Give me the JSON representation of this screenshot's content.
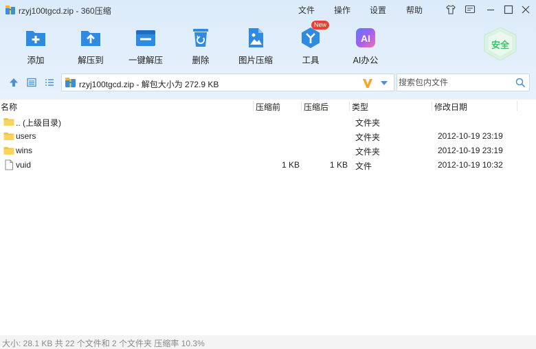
{
  "window": {
    "title": "rzyj100tgcd.zip - 360压缩",
    "menus": [
      "文件",
      "操作",
      "设置",
      "帮助"
    ]
  },
  "toolbar": {
    "items": [
      {
        "label": "添加",
        "icon": "add-icon"
      },
      {
        "label": "解压到",
        "icon": "extract-to-icon"
      },
      {
        "label": "一键解压",
        "icon": "one-click-extract-icon"
      },
      {
        "label": "删除",
        "icon": "delete-icon"
      },
      {
        "label": "图片压缩",
        "icon": "image-compress-icon"
      },
      {
        "label": "工具",
        "icon": "tools-icon"
      },
      {
        "label": "AI办公",
        "icon": "ai-office-icon"
      }
    ],
    "new_badge": "New",
    "safe_badge": "安全"
  },
  "address": {
    "text": "rzyj100tgcd.zip - 解包大小为 272.9 KB"
  },
  "search": {
    "placeholder": "搜索包内文件"
  },
  "list": {
    "columns": {
      "name": "名称",
      "compressed_before": "压缩前",
      "compressed_after": "压缩后",
      "type": "类型",
      "modified": "修改日期"
    },
    "rows": [
      {
        "icon": "folder-icon",
        "name": ".. (上级目录)",
        "before": "",
        "after": "",
        "type": "文件夹",
        "modified": ""
      },
      {
        "icon": "folder-icon",
        "name": "users",
        "before": "",
        "after": "",
        "type": "文件夹",
        "modified": "2012-10-19 23:19"
      },
      {
        "icon": "folder-icon",
        "name": "wins",
        "before": "",
        "after": "",
        "type": "文件夹",
        "modified": "2012-10-19 23:19"
      },
      {
        "icon": "file-icon",
        "name": "vuid",
        "before": "1 KB",
        "after": "1 KB",
        "type": "文件",
        "modified": "2012-10-19 10:32"
      }
    ]
  },
  "status": {
    "text": "大小: 28.1 KB 共 22 个文件和 2 个文件夹 压缩率 10.3%"
  },
  "colors": {
    "accent": "#2f8be0",
    "folder": "#f5c342",
    "safe_green": "#3cc46a"
  }
}
